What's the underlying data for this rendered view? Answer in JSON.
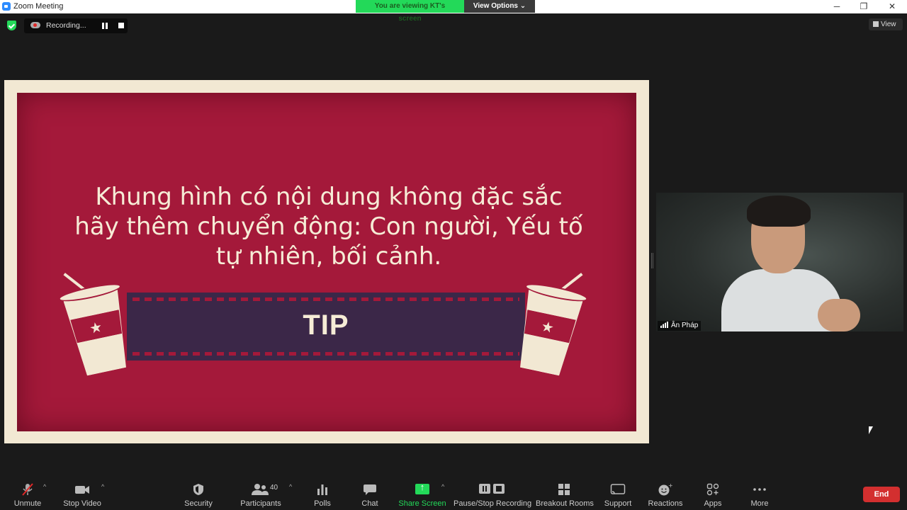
{
  "window": {
    "title": "Zoom Meeting",
    "controls": {
      "minimize": "─",
      "restore": "❐",
      "close": "✕"
    }
  },
  "banner": {
    "viewing": "You are viewing KT's screen",
    "view_options": "View Options ⌄"
  },
  "recording": {
    "label": "Recording...",
    "status_color": "#23d959"
  },
  "view_button": {
    "label": "View"
  },
  "slide": {
    "lines": [
      "Khung hình có nội dung không đặc sắc",
      "hãy thêm chuyển động: Con người, Yếu tố",
      "tự nhiên, bối cảnh."
    ],
    "tip": "TIP",
    "background_color": "#a4193a",
    "frame_color": "#f2e8d3"
  },
  "participant": {
    "name": "Ân Pháp"
  },
  "toolbar": {
    "unmute": "Unmute",
    "stop_video": "Stop Video",
    "security": "Security",
    "participants": "Participants",
    "participants_count": "40",
    "polls": "Polls",
    "chat": "Chat",
    "share_screen": "Share Screen",
    "pause_stop_recording": "Pause/Stop Recording",
    "breakout_rooms": "Breakout Rooms",
    "support": "Support",
    "reactions": "Reactions",
    "apps": "Apps",
    "more": "More",
    "end": "End"
  },
  "icons": {
    "mic": "mic-muted-icon",
    "video": "video-camera-icon",
    "security": "shield-icon",
    "participants": "people-icon",
    "polls": "bar-chart-icon",
    "chat": "chat-bubble-icon",
    "share": "share-arrow-icon",
    "recording": "pause-stop-icon",
    "breakout": "grid-icon",
    "support": "cast-icon",
    "reactions": "emoji-plus-icon",
    "apps": "apps-icon",
    "more": "ellipsis-icon"
  }
}
